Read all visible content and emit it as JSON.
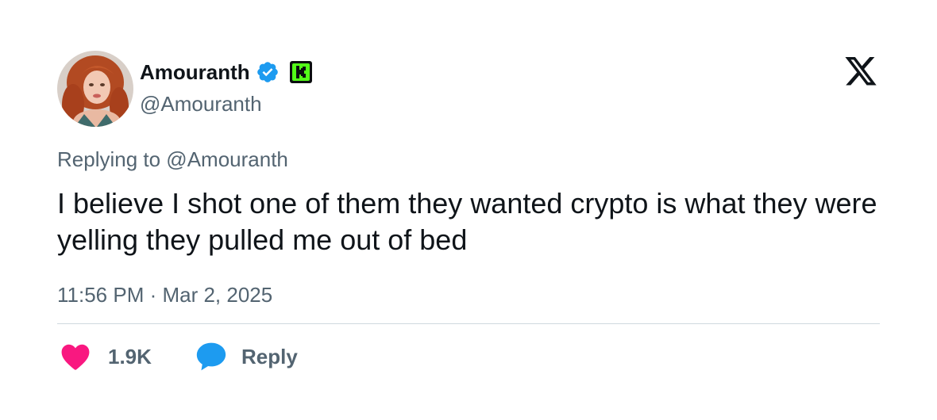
{
  "author": {
    "display_name": "Amouranth",
    "handle": "@Amouranth",
    "verified_icon": "verified-badge-icon",
    "affiliate_badge": "kick-badge-icon"
  },
  "reply_context": "Replying to @Amouranth",
  "tweet": {
    "text": "I believe I shot one of them they wanted crypto is what they were yelling they pulled me out of bed",
    "timestamp": "11:56 PM · Mar 2, 2025"
  },
  "actions": {
    "like_count": "1.9K",
    "reply_label": "Reply"
  },
  "icons": {
    "brand_logo": "x-logo-icon",
    "like": "heart-icon",
    "reply": "reply-bubble-icon"
  },
  "colors": {
    "text_primary": "#0f1419",
    "text_secondary": "#536471",
    "verified_blue": "#1d9bf0",
    "like_pink": "#f91880",
    "kick_green": "#53fc18",
    "divider": "#cfd9de"
  }
}
